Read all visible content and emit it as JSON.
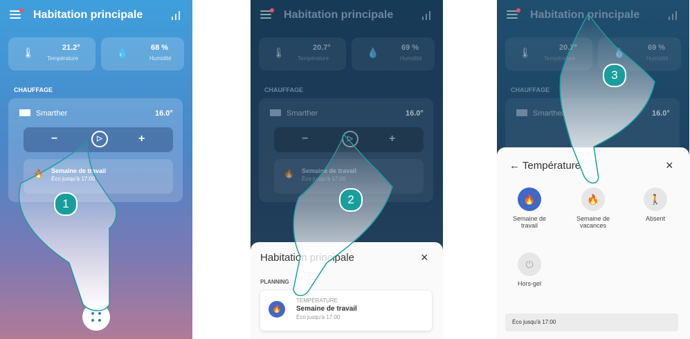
{
  "panel1": {
    "title": "Habitation principale",
    "temperature_value": "21.2°",
    "temperature_label": "Température",
    "humidity_value": "68 %",
    "humidity_label": "Humidité",
    "section": "CHAUFFAGE",
    "device_name": "Smarther",
    "device_temp": "16.0°",
    "minus": "−",
    "plus": "+",
    "schedule_name": "Semaine de travail",
    "schedule_detail": "Éco jusqu'à 17:00",
    "step": "1"
  },
  "panel2": {
    "title": "Habitation principale",
    "temperature_value": "20.7°",
    "temperature_label": "Température",
    "humidity_value": "69 %",
    "humidity_label": "Humidité",
    "section": "CHAUFFAGE",
    "device_name": "Smarther",
    "device_temp": "16.0°",
    "minus": "−",
    "plus": "+",
    "schedule_name": "Semaine de travail",
    "schedule_detail": "Éco jusqu'à 17:00",
    "sheet_title": "Habitation principale",
    "sheet_section": "PLANNING",
    "item_category": "TEMPÉRATURE",
    "item_name": "Semaine de travail",
    "item_detail": "Éco jusqu'à 17:00",
    "close": "×",
    "step": "2"
  },
  "panel3": {
    "title": "Habitation principale",
    "temperature_value": "20.7°",
    "temperature_label": "Température",
    "humidity_value": "69 %",
    "humidity_label": "Humidité",
    "section": "CHAUFFAGE",
    "device_name": "Smarther",
    "device_temp": "16.0°",
    "sheet_title": "← Température",
    "close": "×",
    "modes": [
      "Semaine de travail",
      "Semaine de vacances",
      "Absent",
      "Hors-gel"
    ],
    "footer": "Éco jusqu'à 17:00",
    "step": "3"
  },
  "colors": {
    "accent": "#199e9e",
    "active_mode": "#3f68c9"
  }
}
